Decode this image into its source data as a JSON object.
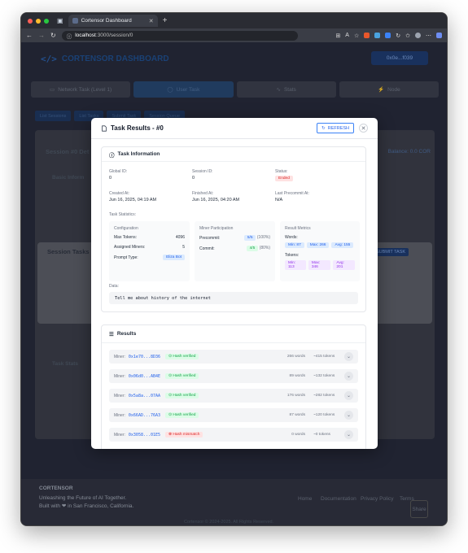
{
  "browser": {
    "tab_title": "Cortensor Dashboard",
    "url_host": "localhost",
    "url_path": ":3000/session/0"
  },
  "app": {
    "logo": "CORTENSOR DASHBOARD",
    "wallet": "0x0e...f039",
    "nav_tabs": [
      "Network Task (Level 1)",
      "User Task",
      "Stats",
      "Node"
    ],
    "sub_buttons": [
      "List Sessions",
      "List Tasks",
      "Submit Task",
      "Session Queue"
    ],
    "session_title": "Session #0 Det",
    "balance": "Balance: 0.0 COR",
    "basic_info": "Basic Inform",
    "session_tasks": "Session Tasks",
    "submit_task": "SUBMIT TASK",
    "task_stats": "Task Stats",
    "footer_brand": "CORTENSOR",
    "footer_tag1": "Unleashing the Future of AI Together.",
    "footer_tag2": "Built with ❤ in San Francisco, California.",
    "footer_links": [
      "Home",
      "Documentation",
      "Privacy Policy",
      "Terms"
    ],
    "share": "Share",
    "copyright": "Cortensor © 2024-2025. All Rights Reserved."
  },
  "modal": {
    "title": "Task Results - #0",
    "refresh": "REFRESH",
    "info": {
      "header": "Task Information",
      "global_id_label": "Global ID:",
      "global_id": "0",
      "session_id_label": "Session ID:",
      "session_id": "0",
      "status_label": "Status:",
      "status": "Ended",
      "created_label": "Created At:",
      "created": "Jun 16, 2025, 04:19 AM",
      "finished_label": "Finished At:",
      "finished": "Jun 16, 2025, 04:20 AM",
      "last_precommit_label": "Last Precommit At:",
      "last_precommit": "N/A",
      "task_stats_label": "Task Statistics:",
      "config": {
        "title": "Configuration",
        "max_tokens_label": "Max Tokens:",
        "max_tokens": "4096",
        "assigned_label": "Assigned Miners:",
        "assigned": "5",
        "prompt_type_label": "Prompt Type:",
        "prompt_type": "Eliza Bot"
      },
      "participation": {
        "title": "Miner Participation",
        "precommit_label": "Precommit:",
        "precommit": "5/5",
        "precommit_pct": "(100%)",
        "commit_label": "Commit:",
        "commit": "4/5",
        "commit_pct": "(80%)"
      },
      "metrics": {
        "title": "Result Metrics",
        "words_label": "Words:",
        "words_min": "Min: 87",
        "words_max": "Max: 266",
        "words_avg": "Avg: 155",
        "tokens_label": "Tokens:",
        "tokens_min": "Min: 113",
        "tokens_max": "Max: 346",
        "tokens_avg": "Avg: 201"
      },
      "data_label": "Data:",
      "data": "Tell me about history of the internet"
    },
    "results": {
      "header": "Results",
      "miner_label": "Miner:",
      "rows": [
        {
          "addr": "0x1e70...8D36",
          "status": "Hash verified",
          "ok": true,
          "words": "266 words",
          "tokens": "~415 tokens"
        },
        {
          "addr": "0x06d0...AB4E",
          "status": "Hash verified",
          "ok": true,
          "words": "89 words",
          "tokens": "~132 tokens"
        },
        {
          "addr": "0x5a8a...07AA",
          "status": "Hash verified",
          "ok": true,
          "words": "176 words",
          "tokens": "~282 tokens"
        },
        {
          "addr": "0x66AD...76A3",
          "status": "Hash verified",
          "ok": true,
          "words": "87 words",
          "tokens": "~120 tokens"
        },
        {
          "addr": "0x3058...01E5",
          "status": "Hash mismatch",
          "ok": false,
          "words": "0 words",
          "tokens": "~0 tokens"
        }
      ]
    }
  }
}
